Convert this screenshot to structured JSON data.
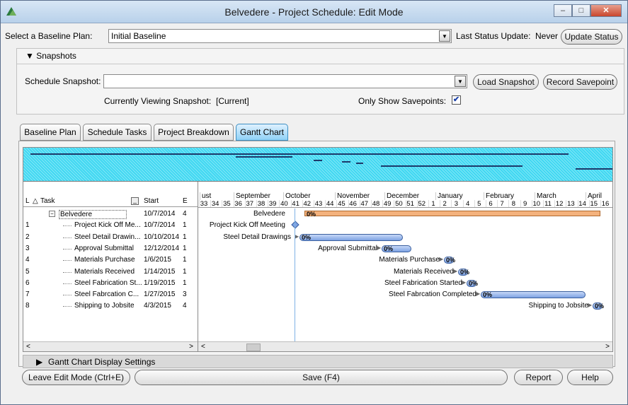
{
  "window": {
    "title": "Belvedere - Project Schedule: Edit Mode",
    "minimize": "–",
    "maximize": "□",
    "close": "✕"
  },
  "baseline": {
    "label": "Select a Baseline Plan:",
    "value": "Initial Baseline",
    "last_update_label": "Last Status Update:",
    "last_update_value": "Never",
    "update_button": "Update Status"
  },
  "snapshots": {
    "header": "Snapshots",
    "snapshot_label": "Schedule Snapshot:",
    "snapshot_value": "",
    "load_button": "Load Snapshot",
    "record_button": "Record Savepoint",
    "viewing_label": "Currently Viewing Snapshot:",
    "viewing_value": "[Current]",
    "savepoints_label": "Only Show Savepoints:",
    "savepoints_checked": true
  },
  "tabs": [
    "Baseline Plan",
    "Schedule Tasks",
    "Project Breakdown",
    "Gantt Chart"
  ],
  "active_tab": "Gantt Chart",
  "gantt": {
    "columns": {
      "l": "L",
      "sort": "△",
      "task": "Task",
      "start": "Start",
      "e": "E"
    },
    "months": [
      "ust",
      "September",
      "October",
      "November",
      "December",
      "January",
      "February",
      "March",
      "April"
    ],
    "weeks": [
      "33",
      "34",
      "35",
      "36",
      "37",
      "38",
      "39",
      "40",
      "41",
      "42",
      "43",
      "44",
      "45",
      "46",
      "47",
      "48",
      "49",
      "50",
      "51",
      "52",
      "1",
      "2",
      "3",
      "4",
      "5",
      "6",
      "7",
      "8",
      "9",
      "10",
      "11",
      "12",
      "13",
      "14",
      "15",
      "16"
    ],
    "rows": [
      {
        "num": "",
        "task": "Belvedere",
        "start": "10/7/2014",
        "dur": "4",
        "chart_label": "Belvedere",
        "pct": "0%"
      },
      {
        "num": "1",
        "task": "Project Kick Off Me...",
        "start": "10/7/2014",
        "dur": "1",
        "chart_label": "Project Kick Off Meeting",
        "pct": ""
      },
      {
        "num": "2",
        "task": "Steel Detail Drawin...",
        "start": "10/10/2014",
        "dur": "1",
        "chart_label": "Steel Detail Drawings",
        "pct": "0%"
      },
      {
        "num": "3",
        "task": "Approval Submittal",
        "start": "12/12/2014",
        "dur": "1",
        "chart_label": "Approval Submittal",
        "pct": "0%"
      },
      {
        "num": "4",
        "task": "Materials Purchase",
        "start": "1/6/2015",
        "dur": "1",
        "chart_label": "Materials Purchase",
        "pct": "0%"
      },
      {
        "num": "5",
        "task": "Materials Received",
        "start": "1/14/2015",
        "dur": "1",
        "chart_label": "Materials Received",
        "pct": "0%"
      },
      {
        "num": "6",
        "task": "Steel Fabrication St...",
        "start": "1/19/2015",
        "dur": "1",
        "chart_label": "Steel Fabrication Started",
        "pct": "0%"
      },
      {
        "num": "7",
        "task": "Steel Fabrcation C...",
        "start": "1/27/2015",
        "dur": "3",
        "chart_label": "Steel Fabrcation Completed",
        "pct": "0%"
      },
      {
        "num": "8",
        "task": "Shipping to Jobsite",
        "start": "4/3/2015",
        "dur": "4",
        "chart_label": "Shipping to Jobsite",
        "pct": "0%"
      }
    ]
  },
  "display_settings": "Gantt Chart Display Settings",
  "footer": {
    "leave": "Leave Edit Mode (Ctrl+E)",
    "save": "Save (F4)",
    "report": "Report",
    "help": "Help"
  }
}
